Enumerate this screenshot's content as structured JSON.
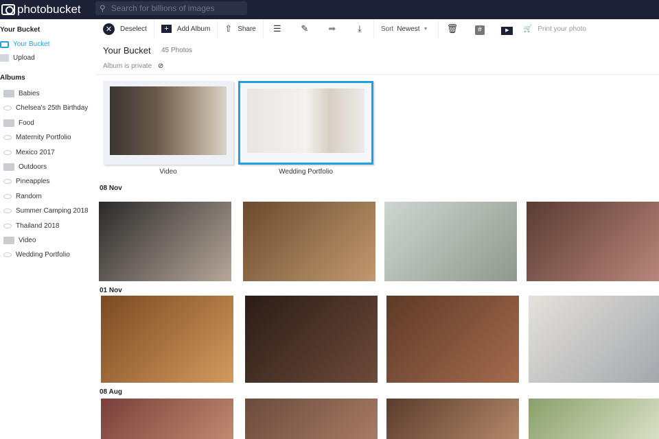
{
  "header": {
    "logo": "photobucket",
    "search_placeholder": "Search for billions of images"
  },
  "sidebar": {
    "section1": "Your Bucket",
    "items": [
      {
        "label": "Your Bucket"
      },
      {
        "label": "Upload"
      }
    ],
    "albums_heading": "Albums",
    "albums": [
      {
        "label": "Babies",
        "icon": "folder"
      },
      {
        "label": "Chelsea's 25th Birthday",
        "icon": "eye"
      },
      {
        "label": "Food",
        "icon": "folder"
      },
      {
        "label": "Maternity Portfolio",
        "icon": "eye"
      },
      {
        "label": "Mexico 2017",
        "icon": "eye"
      },
      {
        "label": "Outdoors",
        "icon": "folder"
      },
      {
        "label": "Pineapples",
        "icon": "eye"
      },
      {
        "label": "Random",
        "icon": "eye"
      },
      {
        "label": "Summer Camping 2018",
        "icon": "eye"
      },
      {
        "label": "Thailand 2018",
        "icon": "eye"
      },
      {
        "label": "Video",
        "icon": "folder"
      },
      {
        "label": "Wedding Portfolio",
        "icon": "eye"
      }
    ]
  },
  "toolbar": {
    "deselect": "Deselect",
    "add_album": "Add Album",
    "share": "Share",
    "sort": "Sort",
    "sort_value": "Newest",
    "print": "Print your photo"
  },
  "main": {
    "title": "Your Bucket",
    "count": "45 Photos",
    "privacy": "Album is private",
    "album_cards": [
      {
        "label": "Video"
      },
      {
        "label": "Wedding Portfolio"
      }
    ],
    "groups": [
      {
        "date": "08 Nov"
      },
      {
        "date": "01 Nov"
      },
      {
        "date": "08 Aug"
      }
    ]
  },
  "colors": {
    "accent": "#1ea1e4",
    "topbar": "#1d2135"
  }
}
